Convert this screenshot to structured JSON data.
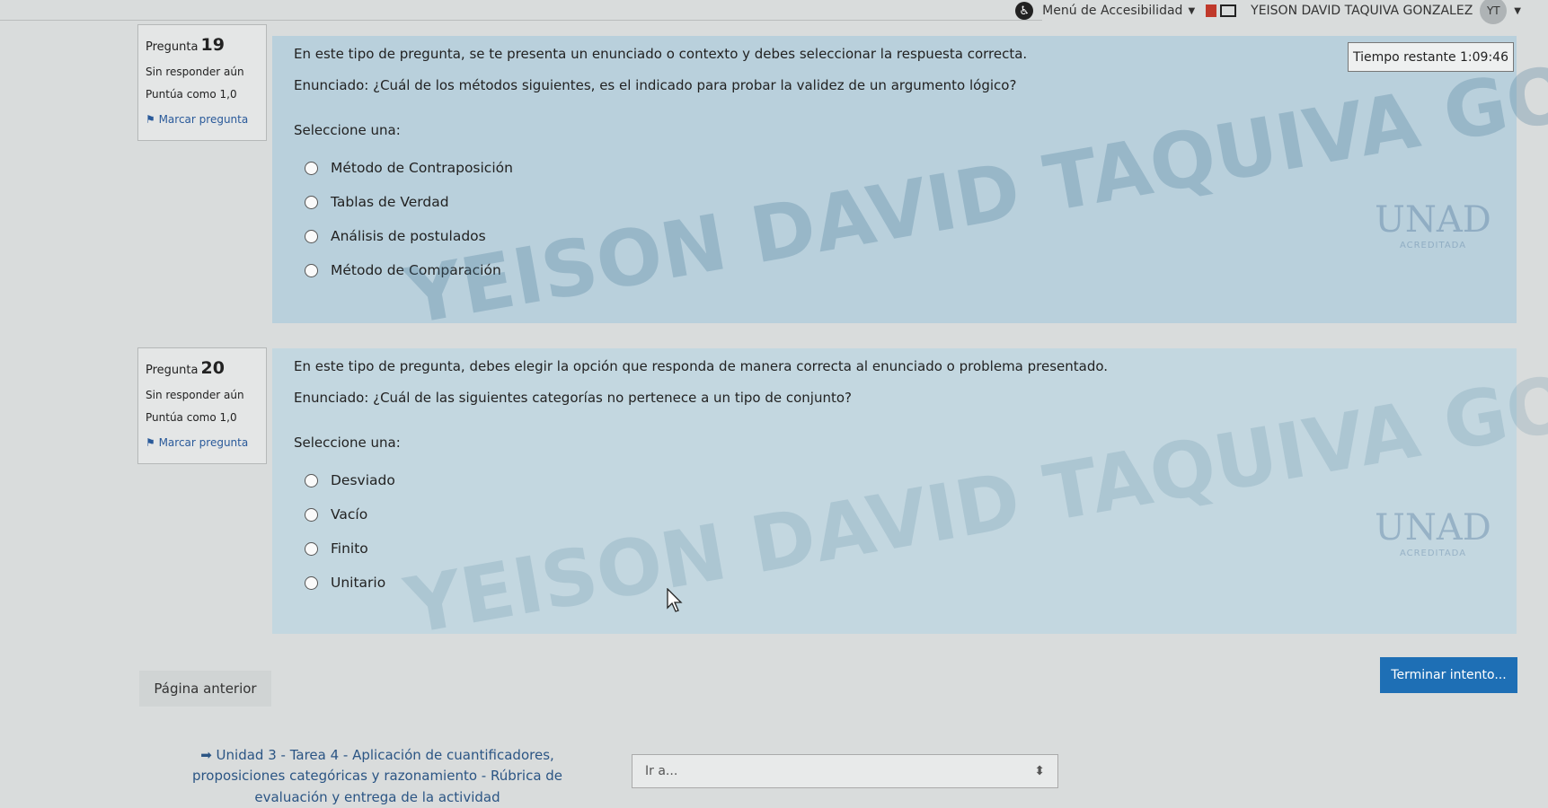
{
  "topbar": {
    "accessibility_menu": "Menú de Accesibilidad",
    "username": "YEISON DAVID TAQUIVA GONZALEZ",
    "avatar_initials": "YT"
  },
  "timer": {
    "label": "Tiempo restante 1:09:46"
  },
  "watermark": {
    "text": "YEISON DAVID TAQUIVA GONZALEZ"
  },
  "logo": {
    "text": "UNAD",
    "badge": "ACREDITADA"
  },
  "questions": [
    {
      "number_label": "Pregunta",
      "number": "19",
      "status": "Sin responder aún",
      "score": "Puntúa como 1,0",
      "flag": "Marcar pregunta",
      "intro": "En este tipo de pregunta, se te presenta un enunciado o contexto y debes seleccionar la respuesta correcta.",
      "statement": "Enunciado: ¿Cuál de los métodos siguientes, es el indicado para probar la validez de un argumento lógico?",
      "select_label": "Seleccione una:",
      "options": [
        "Método de Contraposición",
        "Tablas de Verdad",
        "Análisis de postulados",
        "Método de Comparación"
      ]
    },
    {
      "number_label": "Pregunta",
      "number": "20",
      "status": "Sin responder aún",
      "score": "Puntúa como 1,0",
      "flag": "Marcar pregunta",
      "intro": "En este tipo de pregunta, debes elegir la opción que responda de manera correcta al enunciado o problema presentado.",
      "statement": "Enunciado: ¿Cuál de las siguientes categorías no pertenece a un tipo de conjunto?",
      "select_label": "Seleccione una:",
      "options": [
        "Desviado",
        "Vacío",
        "Finito",
        "Unitario"
      ]
    }
  ],
  "nav": {
    "prev_label": "Página anterior",
    "finish_label": "Terminar intento...",
    "footer_link": "➡ Unidad 3 - Tarea 4 - Aplicación de cuantificadores, proposiciones categóricas y razonamiento - Rúbrica de evaluación y entrega de la actividad",
    "goto_placeholder": "Ir a..."
  }
}
